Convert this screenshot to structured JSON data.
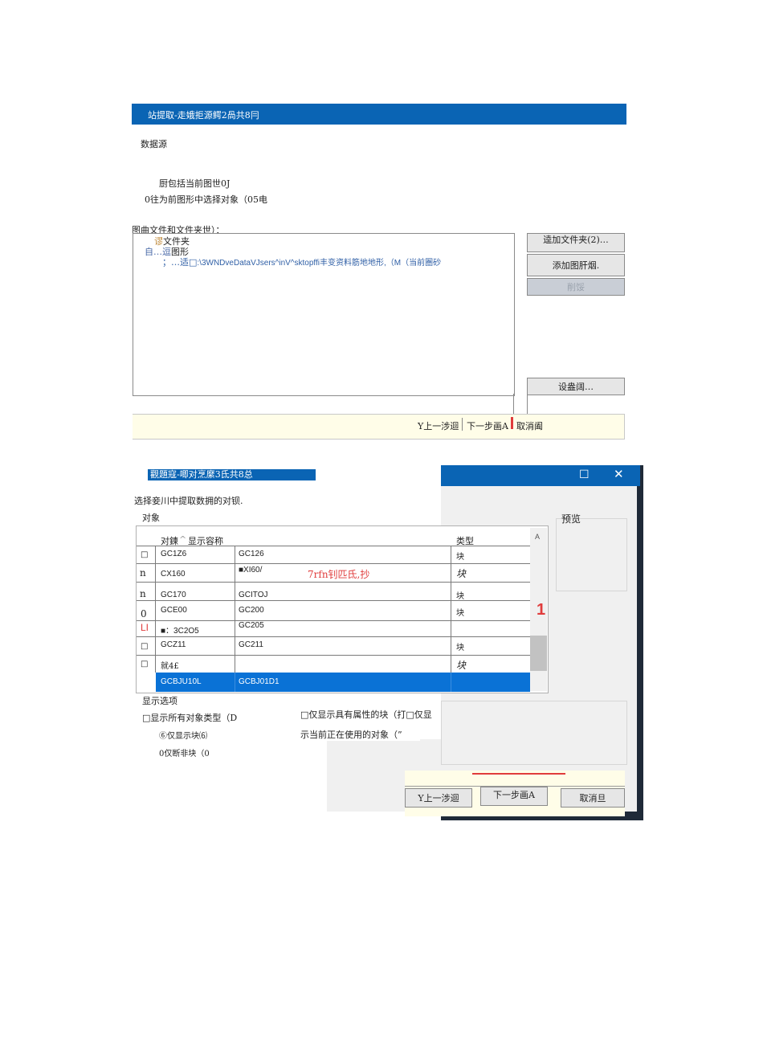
{
  "dialog1": {
    "title": "站提取-走娥拒源鳄2咼共8冃",
    "data_source_label": "数据源",
    "radio_include_current": "厨包括当前图世0J",
    "radio_select_objects": "0往为前图形中选择对象（05电",
    "files_label": "图曲文件和文件夹世）：",
    "tree_items": [
      {
        "prefix": "谬",
        "text": "文件夹"
      },
      {
        "prefix": "自…逗",
        "text": "图形"
      },
      {
        "prefix": "；…适□",
        "text": ":\\3WNDveDataVJsers^inV^sktopffi丰变资料筋地地形,（M（当前圏砂"
      }
    ],
    "buttons": {
      "add_folder": "逵加文件夹(2)…",
      "add_drawing": "添加图肝烟.",
      "delete": "削馁",
      "settings": "设盎阔…"
    },
    "footer": {
      "back": "Y上一涉迴",
      "next": "下一步画A",
      "cancel": "取消阖"
    }
  },
  "dialog2": {
    "title": "觀題寇-唧对烹縻3氐共8总",
    "instruction": "选择妾川中提取数拥的对钡.",
    "objects_label": "对象",
    "table_headers": {
      "name": "对鍊",
      "display_name": "显示容称",
      "type": "类型"
    },
    "scroll_up_glyph": "A",
    "rows": [
      {
        "check": "□",
        "name": "GC1Z6",
        "display": "GC126",
        "type": "块",
        "selected": false
      },
      {
        "check": "n",
        "name": "CX160",
        "display": "■XI60/",
        "annotation": "7rfn钊匹氐,抄",
        "type": "块",
        "selected": false
      },
      {
        "check": "n",
        "name": "GC170",
        "display": "GCITOJ",
        "type": "块",
        "selected": false
      },
      {
        "check": "0",
        "name": "GCE00",
        "display": "GC200",
        "type": "块",
        "selected": false
      },
      {
        "check": "LI",
        "name": "■：3C2O5",
        "display": "GC205",
        "type": "",
        "selected": false
      },
      {
        "check": "□",
        "name": "GCZ11",
        "display": "GC211",
        "type": "块",
        "selected": false
      },
      {
        "check": "□",
        "name": "就4£",
        "display": "",
        "type": "块",
        "selected": false
      },
      {
        "check": "",
        "name": "GCBJU10L",
        "display": "GCBJ01D1",
        "type": "",
        "selected": true
      }
    ],
    "side_marker": "1",
    "preview_label": "预览",
    "display_options_label": "显示选项",
    "options": {
      "show_all_types": "□显示所有对象类型（D",
      "only_blocks": "⑥仅显示块⑹",
      "only_non_blocks": "0仅断非块（0",
      "attr_blocks": "□仅显示具有属性的块（打□仅显",
      "in_use": "示当前正在使用的对象（”"
    },
    "window_controls": {
      "maximize": "☐",
      "close": "✕"
    },
    "footer": {
      "back": "Y上一涉迴",
      "next": "下一步画A",
      "cancel": "取消旦"
    }
  },
  "colors": {
    "title_blue": "#0a64b4",
    "selection_blue": "#0a72d6",
    "red_annotation": "#e03c3c",
    "footer_bg": "#fffde8"
  }
}
